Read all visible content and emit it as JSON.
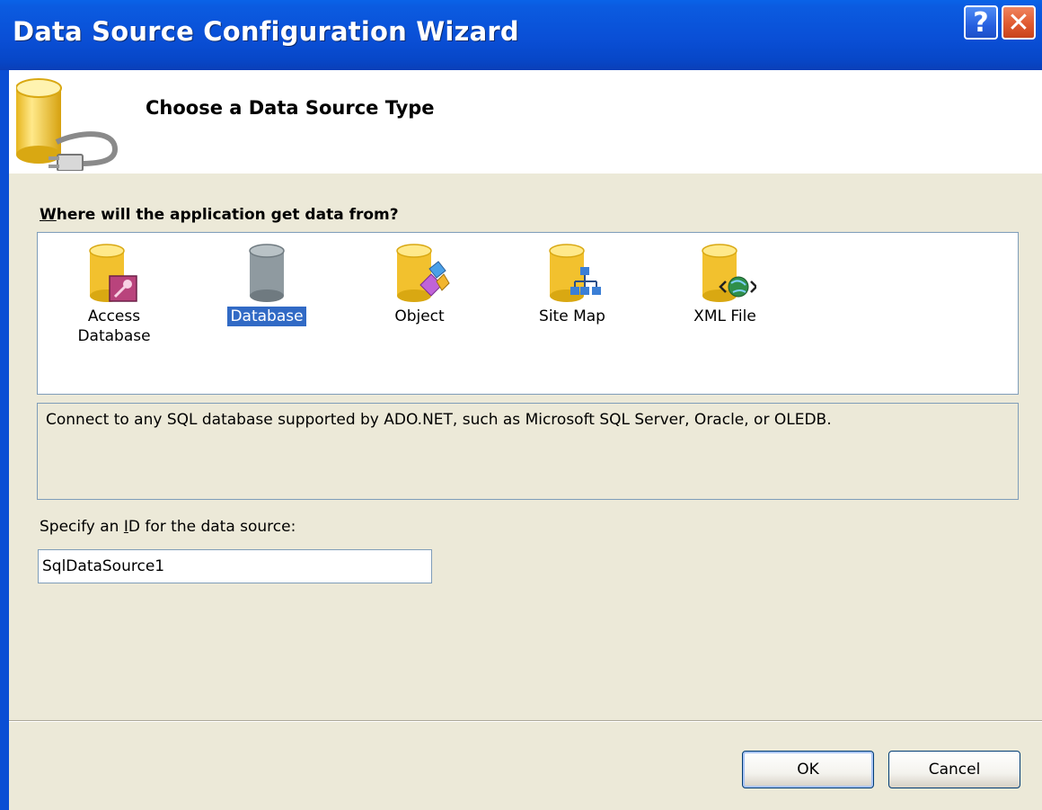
{
  "window": {
    "title": "Data Source Configuration Wizard",
    "help_glyph": "?",
    "close_glyph": "✕"
  },
  "header": {
    "title": "Choose a Data Source Type",
    "icon": "database-plug-icon"
  },
  "source_list": {
    "prompt_accel": "W",
    "prompt_rest": "here will the application get data from?",
    "items": [
      {
        "label": "Access\nDatabase",
        "icon": "access-database-icon",
        "selected": false
      },
      {
        "label": "Database",
        "icon": "database-icon",
        "selected": true
      },
      {
        "label": "Object",
        "icon": "object-icon",
        "selected": false
      },
      {
        "label": "Site Map",
        "icon": "site-map-icon",
        "selected": false
      },
      {
        "label": "XML File",
        "icon": "xml-file-icon",
        "selected": false
      }
    ],
    "description": "Connect to any SQL database supported by ADO.NET, such as Microsoft SQL Server, Oracle, or OLEDB."
  },
  "id_field": {
    "label_before": "Specify an ",
    "label_accel": "I",
    "label_after": "D for the data source:",
    "value": "SqlDataSource1"
  },
  "buttons": {
    "ok": "OK",
    "cancel": "Cancel"
  },
  "colors": {
    "titlebar": "#0a4fd6",
    "dialog_face": "#ece9d8",
    "selection": "#316ac5",
    "database_yellow": "#f2c12e"
  }
}
